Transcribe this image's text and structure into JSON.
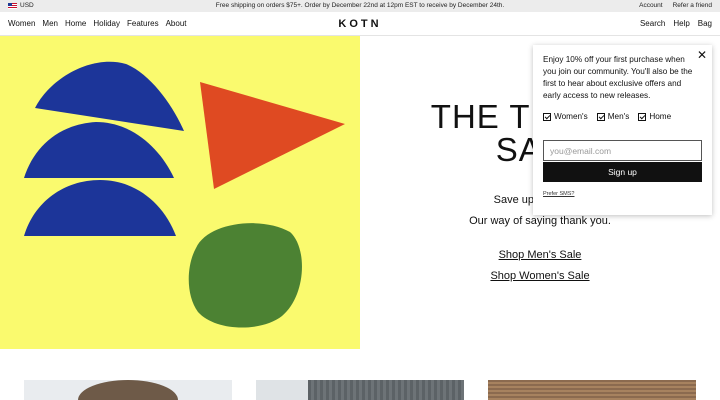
{
  "topbar": {
    "currency": "USD",
    "promo": "Free shipping on orders $75+. Order by December 22nd at 12pm EST to receive by December 24th.",
    "account": "Account",
    "refer": "Refer a friend"
  },
  "nav": {
    "left": [
      "Women",
      "Men",
      "Home",
      "Holiday",
      "Features",
      "About"
    ],
    "logo": "KOTN",
    "right": [
      "Search",
      "Help",
      "Bag"
    ]
  },
  "hero": {
    "headline_line1": "THE THANKS",
    "headline_line2": "SALE",
    "subline": "Save up to 50% off",
    "subline2": "Our way of saying thank you.",
    "shop_men": "Shop Men's Sale",
    "shop_women": "Shop Women's Sale",
    "colors": {
      "background": "#fafa6e",
      "blue": "#1c3599",
      "orange": "#df4a22",
      "green": "#4c8233"
    }
  },
  "popup": {
    "close_icon": "close-icon",
    "message": "Enjoy 10% off your first purchase when you join our community. You'll also be the first to hear about exclusive offers and early access to new releases.",
    "checkboxes": [
      {
        "label": "Women's",
        "checked": true
      },
      {
        "label": "Men's",
        "checked": true
      },
      {
        "label": "Home",
        "checked": true
      }
    ],
    "email_placeholder": "you@email.com",
    "signup_label": "Sign up",
    "sms_link": "Prefer SMS?"
  }
}
